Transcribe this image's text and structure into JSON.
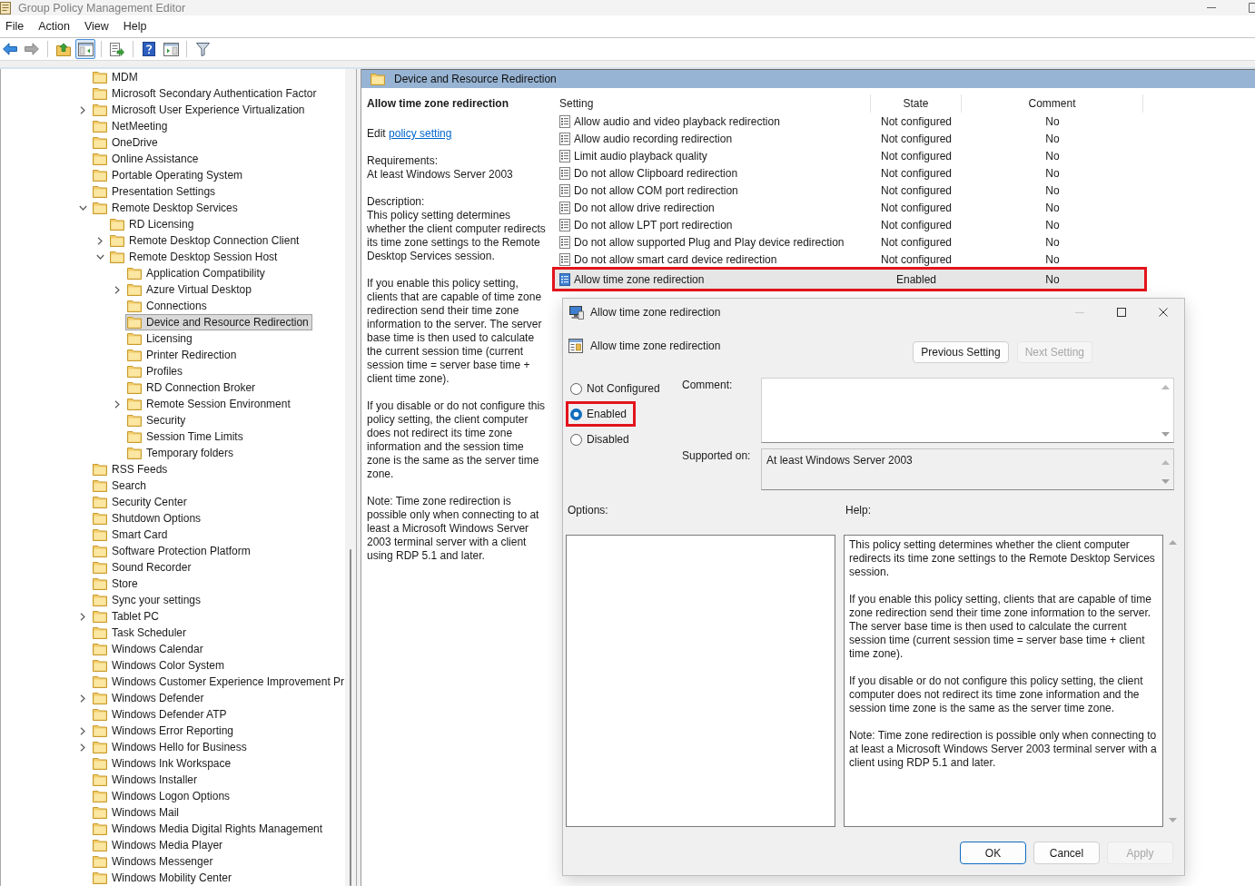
{
  "window": {
    "title": "Group Policy Management Editor"
  },
  "menu": [
    "File",
    "Action",
    "View",
    "Help"
  ],
  "toolbar": {
    "groups": [
      [
        {
          "kind": "back",
          "disabled": false,
          "pressed": false
        },
        {
          "kind": "forward",
          "disabled": true,
          "pressed": false
        }
      ],
      [
        {
          "kind": "up",
          "disabled": false,
          "pressed": false
        },
        {
          "kind": "tree",
          "disabled": false,
          "pressed": true
        }
      ],
      [
        {
          "kind": "export",
          "disabled": false,
          "pressed": false
        }
      ],
      [
        {
          "kind": "help",
          "disabled": false,
          "pressed": false
        },
        {
          "kind": "pane",
          "disabled": false,
          "pressed": false
        }
      ],
      [
        {
          "kind": "filter",
          "disabled": false,
          "pressed": false
        }
      ]
    ]
  },
  "tree": {
    "items": [
      {
        "label": "MDM",
        "selected": false
      },
      {
        "label": "Microsoft Secondary Authentication Factor",
        "selected": false
      },
      {
        "label": "Microsoft User Experience Virtualization",
        "expanded": false,
        "selected": false
      },
      {
        "label": "NetMeeting",
        "selected": false
      },
      {
        "label": "OneDrive",
        "selected": false
      },
      {
        "label": "Online Assistance",
        "selected": false
      },
      {
        "label": "Portable Operating System",
        "selected": false
      },
      {
        "label": "Presentation Settings",
        "selected": false
      },
      {
        "label": "Remote Desktop Services",
        "expanded": true,
        "selected": false,
        "children": [
          {
            "label": "RD Licensing",
            "selected": false
          },
          {
            "label": "Remote Desktop Connection Client",
            "expanded": false,
            "selected": false
          },
          {
            "label": "Remote Desktop Session Host",
            "expanded": true,
            "selected": false,
            "children": [
              {
                "label": "Application Compatibility",
                "selected": false
              },
              {
                "label": "Azure Virtual Desktop",
                "expanded": false,
                "selected": false
              },
              {
                "label": "Connections",
                "selected": false
              },
              {
                "label": "Device and Resource Redirection",
                "selected": true
              },
              {
                "label": "Licensing",
                "selected": false
              },
              {
                "label": "Printer Redirection",
                "selected": false
              },
              {
                "label": "Profiles",
                "selected": false
              },
              {
                "label": "RD Connection Broker",
                "selected": false
              },
              {
                "label": "Remote Session Environment",
                "expanded": false,
                "selected": false
              },
              {
                "label": "Security",
                "selected": false
              },
              {
                "label": "Session Time Limits",
                "selected": false
              },
              {
                "label": "Temporary folders",
                "selected": false
              }
            ]
          }
        ]
      },
      {
        "label": "RSS Feeds",
        "selected": false
      },
      {
        "label": "Search",
        "selected": false
      },
      {
        "label": "Security Center",
        "selected": false
      },
      {
        "label": "Shutdown Options",
        "selected": false
      },
      {
        "label": "Smart Card",
        "selected": false
      },
      {
        "label": "Software Protection Platform",
        "selected": false
      },
      {
        "label": "Sound Recorder",
        "selected": false
      },
      {
        "label": "Store",
        "selected": false
      },
      {
        "label": "Sync your settings",
        "selected": false
      },
      {
        "label": "Tablet PC",
        "expanded": false,
        "selected": false
      },
      {
        "label": "Task Scheduler",
        "selected": false
      },
      {
        "label": "Windows Calendar",
        "selected": false
      },
      {
        "label": "Windows Color System",
        "selected": false
      },
      {
        "label": "Windows Customer Experience Improvement Pr",
        "selected": false
      },
      {
        "label": "Windows Defender",
        "expanded": false,
        "selected": false
      },
      {
        "label": "Windows Defender ATP",
        "selected": false
      },
      {
        "label": "Windows Error Reporting",
        "expanded": false,
        "selected": false
      },
      {
        "label": "Windows Hello for Business",
        "expanded": false,
        "selected": false
      },
      {
        "label": "Windows Ink Workspace",
        "selected": false
      },
      {
        "label": "Windows Installer",
        "selected": false
      },
      {
        "label": "Windows Logon Options",
        "selected": false
      },
      {
        "label": "Windows Mail",
        "selected": false
      },
      {
        "label": "Windows Media Digital Rights Management",
        "selected": false
      },
      {
        "label": "Windows Media Player",
        "selected": false
      },
      {
        "label": "Windows Messenger",
        "selected": false
      },
      {
        "label": "Windows Mobility Center",
        "selected": false
      }
    ]
  },
  "details_header": {
    "title": "Device and Resource Redirection"
  },
  "description_panel": {
    "title": "Allow time zone redirection",
    "edit_prefix": "Edit",
    "edit_link": "policy setting",
    "requirements_label": "Requirements:",
    "requirements": "At least Windows Server 2003",
    "description_label": "Description:",
    "paragraphs": [
      "This policy setting determines whether the client computer redirects its time zone settings to the Remote Desktop Services session.",
      "If you enable this policy setting, clients that are capable of time zone redirection send their time zone information to the server. The server base time is then used to calculate the current session time (current session time = server base time + client time zone).",
      "If you disable or do not configure this policy setting, the client computer does not redirect its time zone information and the session time zone is the same as the server time zone.",
      "Note: Time zone redirection is possible only when connecting to at least a Microsoft Windows Server 2003 terminal server with a client using RDP 5.1 and later."
    ]
  },
  "settings_table": {
    "columns": [
      "Setting",
      "State",
      "Comment"
    ],
    "rows": [
      {
        "setting": "Allow audio and video playback redirection",
        "state": "Not configured",
        "comment": "No",
        "selected": false,
        "annotated": false
      },
      {
        "setting": "Allow audio recording redirection",
        "state": "Not configured",
        "comment": "No",
        "selected": false,
        "annotated": false
      },
      {
        "setting": "Limit audio playback quality",
        "state": "Not configured",
        "comment": "No",
        "selected": false,
        "annotated": false
      },
      {
        "setting": "Do not allow Clipboard redirection",
        "state": "Not configured",
        "comment": "No",
        "selected": false,
        "annotated": false
      },
      {
        "setting": "Do not allow COM port redirection",
        "state": "Not configured",
        "comment": "No",
        "selected": false,
        "annotated": false
      },
      {
        "setting": "Do not allow drive redirection",
        "state": "Not configured",
        "comment": "No",
        "selected": false,
        "annotated": false
      },
      {
        "setting": "Do not allow LPT port redirection",
        "state": "Not configured",
        "comment": "No",
        "selected": false,
        "annotated": false
      },
      {
        "setting": "Do not allow supported Plug and Play device redirection",
        "state": "Not configured",
        "comment": "No",
        "selected": false,
        "annotated": false
      },
      {
        "setting": "Do not allow smart card device redirection",
        "state": "Not configured",
        "comment": "No",
        "selected": false,
        "annotated": false
      },
      {
        "setting": "Allow time zone redirection",
        "state": "Enabled",
        "comment": "No",
        "selected": true,
        "annotated": true
      }
    ]
  },
  "dialog": {
    "title": "Allow time zone redirection",
    "minimize_disabled": true,
    "heading": "Allow time zone redirection",
    "nav_buttons": [
      {
        "label": "Previous Setting",
        "disabled": false
      },
      {
        "label": "Next Setting",
        "disabled": true
      }
    ],
    "options": [
      {
        "label": "Not Configured",
        "selected": false,
        "annotated": false
      },
      {
        "label": "Enabled",
        "selected": true,
        "annotated": true
      },
      {
        "label": "Disabled",
        "selected": false,
        "annotated": false
      }
    ],
    "comment_label": "Comment:",
    "supported_label": "Supported on:",
    "supported_value": "At least Windows Server 2003",
    "options_label": "Options:",
    "help_label": "Help:",
    "help_paragraphs": [
      "This policy setting determines whether the client computer redirects its time zone settings to the Remote Desktop Services session.",
      "If you enable this policy setting, clients that are capable of time zone redirection send their time zone information to the server. The server base time is then used to calculate the current session time (current session time = server base time + client time zone).",
      "If you disable or do not configure this policy setting, the client computer does not redirect its time zone information and the session time zone is the same as the server time zone.",
      "Note: Time zone redirection is possible only when connecting to at least a Microsoft Windows Server 2003 terminal server with a client using RDP 5.1 and later."
    ],
    "buttons": [
      {
        "label": "OK",
        "default": true,
        "disabled": false
      },
      {
        "label": "Cancel",
        "default": false,
        "disabled": false
      },
      {
        "label": "Apply",
        "default": false,
        "disabled": true
      }
    ]
  }
}
